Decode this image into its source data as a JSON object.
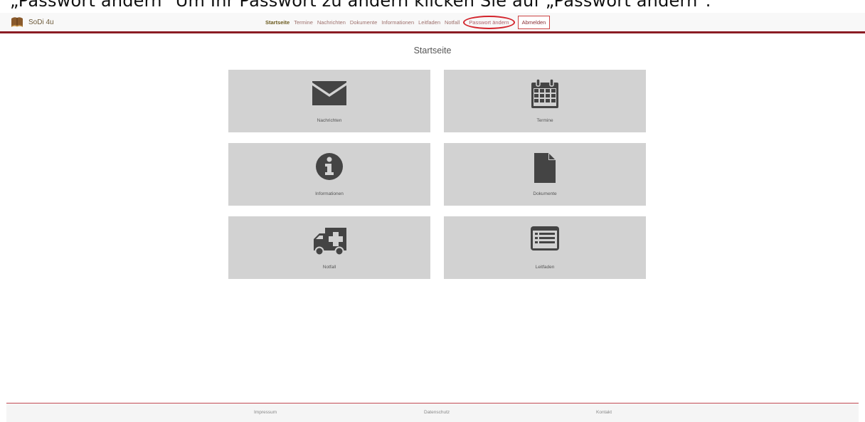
{
  "caption": "„Passwort ändern\" Um Ihr Passwort zu ändern klicken Sie auf „Passwort ändern\".",
  "brand": {
    "name": "SoDi 4u",
    "logo_icon": "book-logo"
  },
  "nav": {
    "items": [
      {
        "label": "Startseite",
        "active": true
      },
      {
        "label": "Termine"
      },
      {
        "label": "Nachrichten"
      },
      {
        "label": "Dokumente"
      },
      {
        "label": "Informationen"
      },
      {
        "label": "Leitfaden"
      },
      {
        "label": "Notfall"
      },
      {
        "label": "Passwort ändern",
        "highlighted": true
      }
    ],
    "logout_label": "Abmelden"
  },
  "page": {
    "title": "Startseite"
  },
  "tiles": [
    {
      "label": "Nachrichten",
      "icon": "envelope-icon"
    },
    {
      "label": "Termine",
      "icon": "calendar-icon"
    },
    {
      "label": "Informationen",
      "icon": "info-icon"
    },
    {
      "label": "Dokumente",
      "icon": "document-icon"
    },
    {
      "label": "Notfall",
      "icon": "ambulance-icon"
    },
    {
      "label": "Leitfaden",
      "icon": "list-icon"
    }
  ],
  "footer": {
    "links": [
      "Impressum",
      "Datenschutz",
      "Kontakt"
    ]
  },
  "colors": {
    "accent": "#8b1c24",
    "tile_bg": "#d2d2d2",
    "icon": "#444444",
    "highlight_ring": "#d3232b"
  }
}
